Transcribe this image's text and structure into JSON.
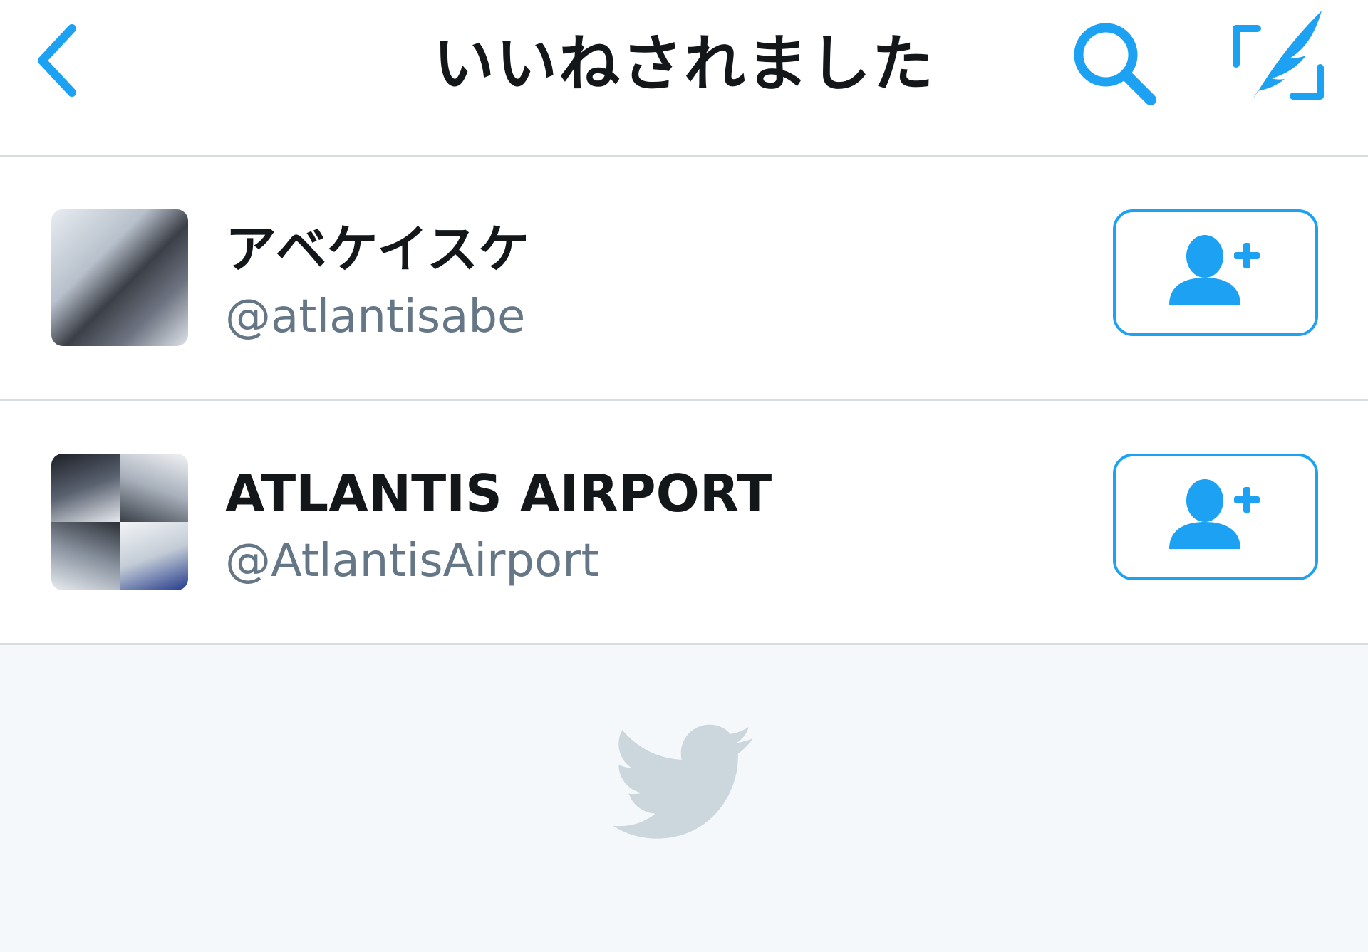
{
  "header": {
    "title": "いいねされました",
    "back_icon": "chevron-left-icon",
    "search_icon": "search-icon",
    "compose_icon": "compose-tweet-icon"
  },
  "users": [
    {
      "name": "アベケイスケ",
      "handle": "@atlantisabe",
      "follow_icon": "follow-user-icon"
    },
    {
      "name": "ATLANTIS AIRPORT",
      "handle": "@AtlantisAirport",
      "follow_icon": "follow-user-icon"
    }
  ],
  "footer": {
    "icon": "twitter-bird-icon"
  },
  "colors": {
    "accent": "#1da1f2",
    "text": "#14171a",
    "secondary_text": "#657786",
    "divider": "#d8dde1",
    "background": "#f5f8fa",
    "bird": "#ccd6dd"
  }
}
